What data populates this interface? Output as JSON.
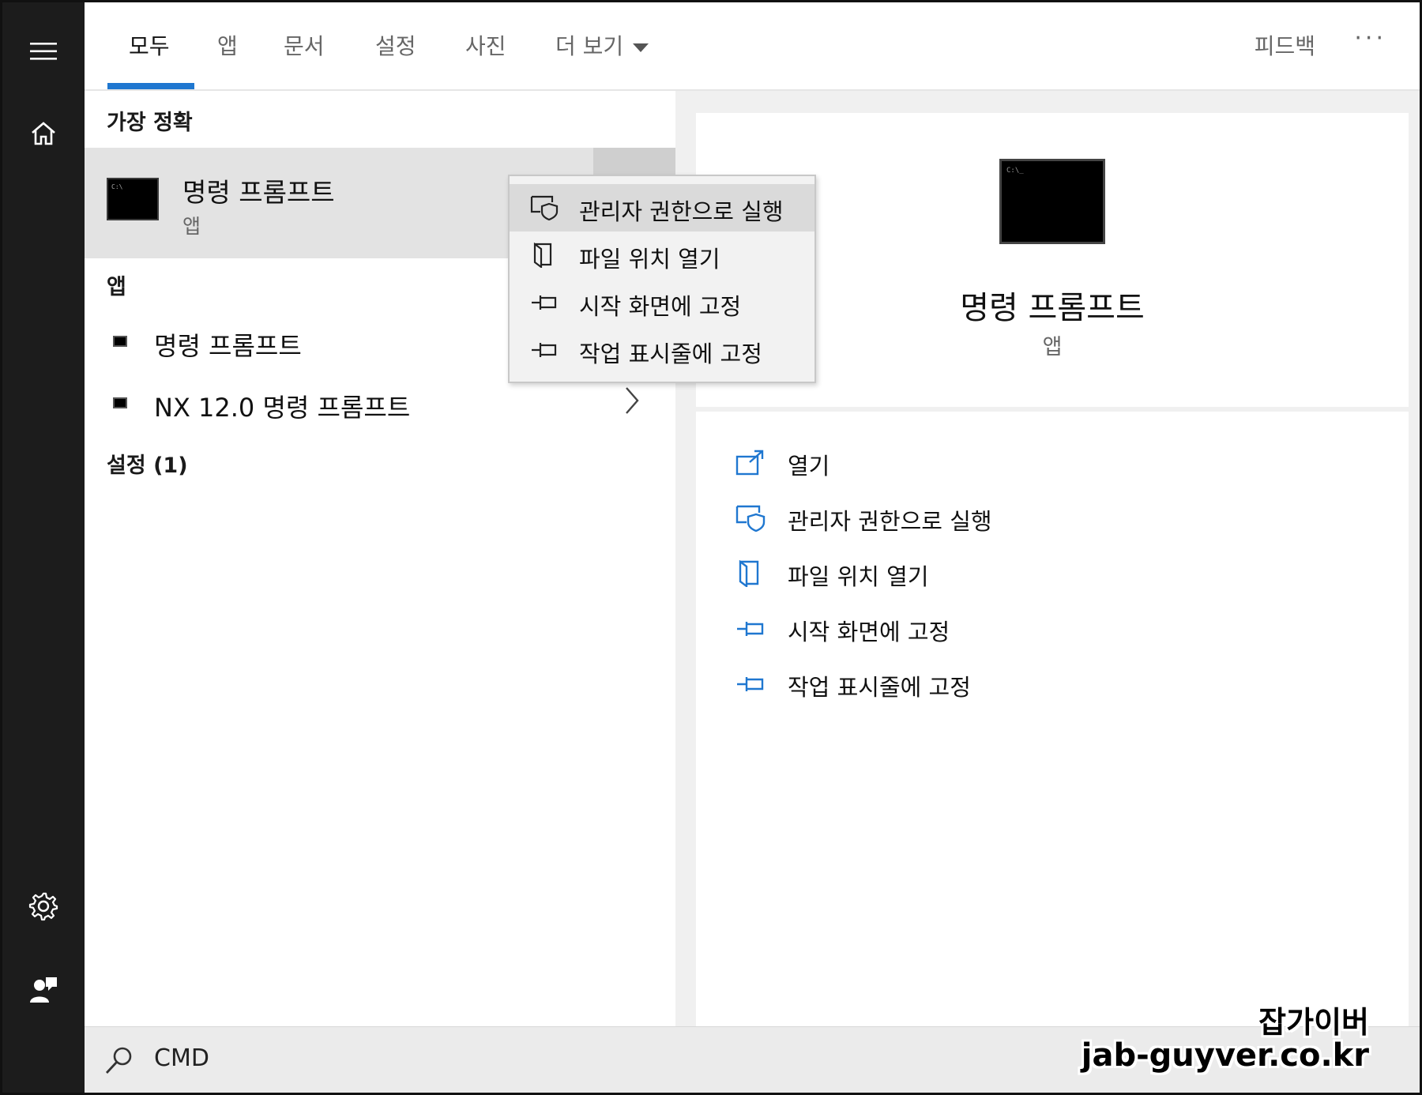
{
  "rail": {
    "icons": [
      "hamburger-menu-icon",
      "home-icon",
      "settings-gear-icon",
      "account-icon"
    ]
  },
  "tabs": {
    "items": [
      {
        "label": "모두",
        "active": true
      },
      {
        "label": "앱",
        "active": false
      },
      {
        "label": "문서",
        "active": false
      },
      {
        "label": "설정",
        "active": false
      },
      {
        "label": "사진",
        "active": false
      },
      {
        "label": "더 보기",
        "active": false
      }
    ],
    "feedback_label": "피드백",
    "more_options_label": "···",
    "active_color": "#1f77d0"
  },
  "results": {
    "best_match_header": "가장 정확",
    "best_match": {
      "title": "명령 프롬프트",
      "subtitle": "앱"
    },
    "apps_header": "앱",
    "apps": [
      {
        "label": "명령 프롬프트"
      },
      {
        "label": "NX 12.0 명령 프롬프트"
      }
    ],
    "settings_header": "설정 (1)"
  },
  "context_menu": {
    "items": [
      {
        "label": "관리자 권한으로 실행",
        "icon": "shield-admin-icon",
        "highlighted": true
      },
      {
        "label": "파일 위치 열기",
        "icon": "file-location-icon",
        "highlighted": false
      },
      {
        "label": "시작 화면에 고정",
        "icon": "pin-icon",
        "highlighted": false
      },
      {
        "label": "작업 표시줄에 고정",
        "icon": "pin-icon",
        "highlighted": false
      }
    ]
  },
  "preview": {
    "title": "명령 프롬프트",
    "subtitle": "앱",
    "actions": [
      {
        "label": "열기",
        "icon": "open-icon"
      },
      {
        "label": "관리자 권한으로 실행",
        "icon": "shield-admin-icon"
      },
      {
        "label": "파일 위치 열기",
        "icon": "file-location-icon"
      },
      {
        "label": "시작 화면에 고정",
        "icon": "pin-icon"
      },
      {
        "label": "작업 표시줄에 고정",
        "icon": "pin-icon"
      }
    ],
    "accent_color": "#1f77d0"
  },
  "search": {
    "value": "CMD",
    "icon": "search-icon"
  },
  "watermark": {
    "line1": "잡가이버",
    "line2": "jab-guyver.co.kr"
  }
}
